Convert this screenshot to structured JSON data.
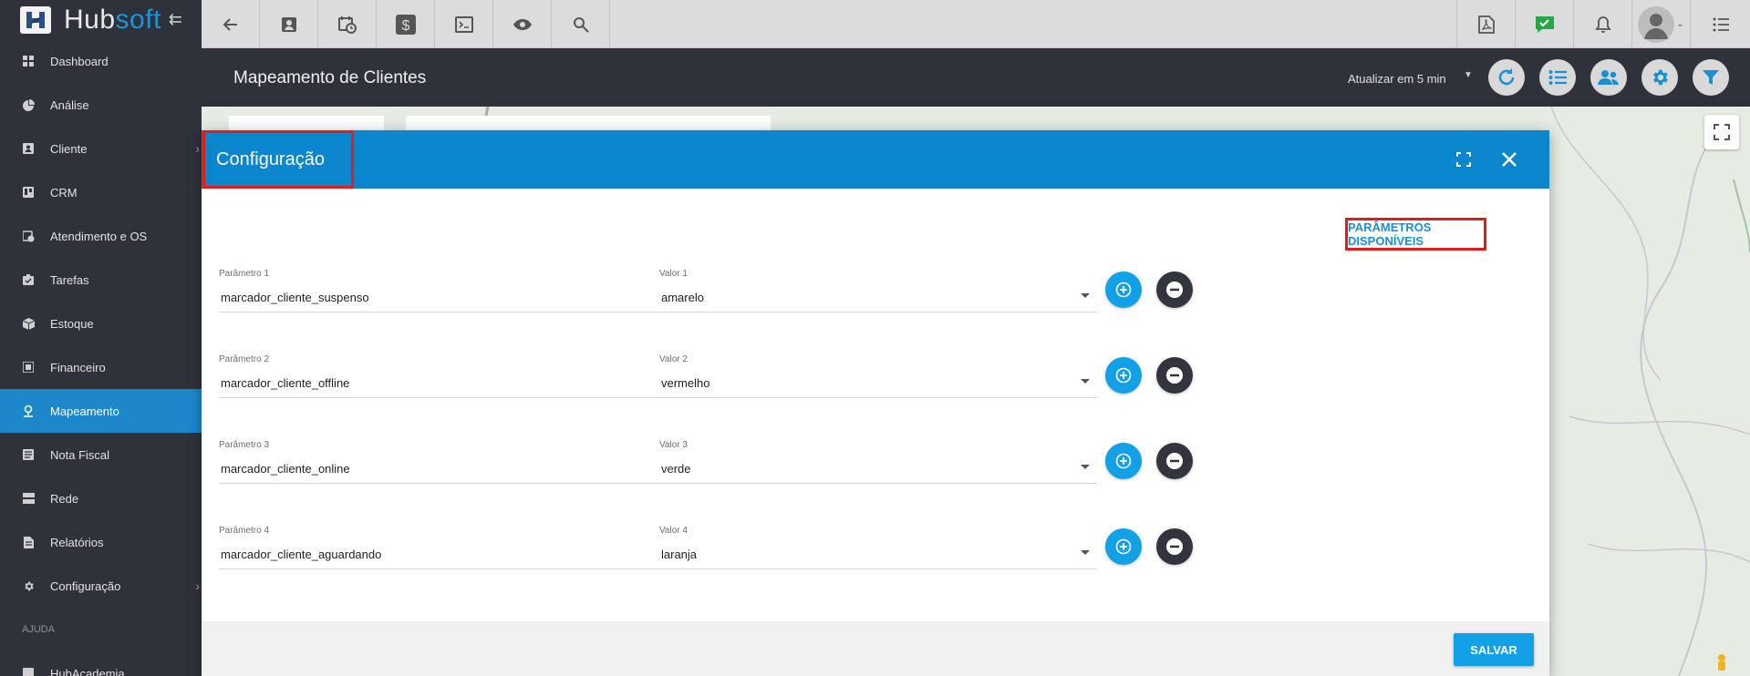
{
  "brand": {
    "hub": "Hub",
    "soft": "soft"
  },
  "sidebar": {
    "items": [
      {
        "label": "Dashboard",
        "icon": "dashboard-icon"
      },
      {
        "label": "Análise",
        "icon": "pie-chart-icon"
      },
      {
        "label": "Cliente",
        "icon": "contact-card-icon",
        "submenu": true
      },
      {
        "label": "CRM",
        "icon": "kanban-icon"
      },
      {
        "label": "Atendimento e OS",
        "icon": "calendar-clock-icon"
      },
      {
        "label": "Tarefas",
        "icon": "tasks-icon"
      },
      {
        "label": "Estoque",
        "icon": "box-icon"
      },
      {
        "label": "Financeiro",
        "icon": "money-icon"
      },
      {
        "label": "Mapeamento",
        "icon": "map-pin-icon",
        "active": true
      },
      {
        "label": "Nota Fiscal",
        "icon": "invoice-icon"
      },
      {
        "label": "Rede",
        "icon": "server-icon"
      },
      {
        "label": "Relatórios",
        "icon": "report-icon"
      },
      {
        "label": "Configuração",
        "icon": "gear-icon",
        "submenu": true
      }
    ],
    "section_help": "AJUDA",
    "help_item": "HubAcademia"
  },
  "header": {
    "title": "Mapeamento de Clientes",
    "refresh_label": "Atualizar em 5 min"
  },
  "modal": {
    "title": "Configuração",
    "params_button": "PARÂMETROS DISPONÍVEIS",
    "rows": [
      {
        "param_label": "Parâmetro 1",
        "param_value": "marcador_cliente_suspenso",
        "value_label": "Valor 1",
        "value": "amarelo"
      },
      {
        "param_label": "Parâmetro 2",
        "param_value": "marcador_cliente_offline",
        "value_label": "Valor 2",
        "value": "vermelho"
      },
      {
        "param_label": "Parâmetro 3",
        "param_value": "marcador_cliente_online",
        "value_label": "Valor 3",
        "value": "verde"
      },
      {
        "param_label": "Parâmetro 4",
        "param_value": "marcador_cliente_aguardando",
        "value_label": "Valor 4",
        "value": "laranja"
      }
    ],
    "save_button": "SALVAR"
  },
  "colors": {
    "primary": "#0a86cf",
    "accent": "#12a0e6",
    "sidebar": "#2f323a",
    "highlight": "#e31b1b"
  }
}
